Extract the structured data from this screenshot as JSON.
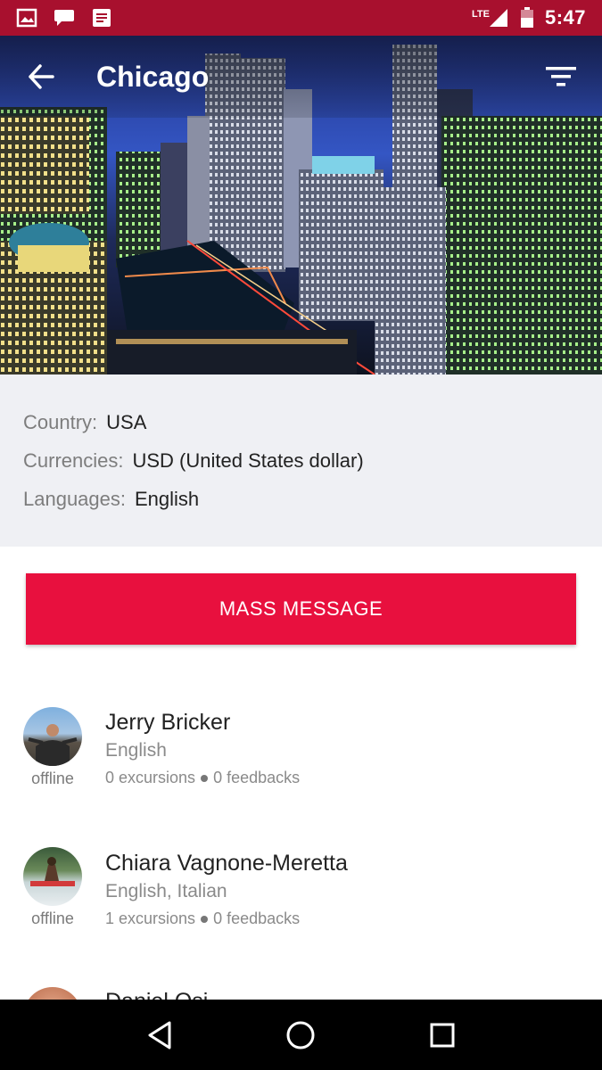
{
  "status_bar": {
    "time": "5:47",
    "network_label": "LTE",
    "icons": [
      "image-icon",
      "chat-icon",
      "notes-icon",
      "signal-icon",
      "battery-icon"
    ],
    "background": "#a8102e"
  },
  "app_bar": {
    "title": "Chicago",
    "back_icon": "arrow-left-icon",
    "filter_icon": "filter-icon"
  },
  "city_info": {
    "country": {
      "label": "Country:",
      "value": "USA"
    },
    "currencies": {
      "label": "Currencies:",
      "value": "USD (United States dollar)"
    },
    "languages": {
      "label": "Languages:",
      "value": "English"
    }
  },
  "mass_message": {
    "label": "MASS MESSAGE",
    "color": "#e8103e"
  },
  "guides": [
    {
      "name": "Jerry Bricker",
      "languages": "English",
      "status": "offline",
      "excursions": "0 excursions",
      "feedbacks": "0 feedbacks"
    },
    {
      "name": "Chiara Vagnone-Meretta",
      "languages": "English, Italian",
      "status": "offline",
      "excursions": "1 excursions",
      "feedbacks": "0 feedbacks"
    },
    {
      "name": "Daniel Osi",
      "languages": "",
      "status": "",
      "excursions": "",
      "feedbacks": ""
    }
  ],
  "nav_bar": {
    "back": "back-triangle-icon",
    "home": "home-circle-icon",
    "recents": "recents-square-icon"
  }
}
